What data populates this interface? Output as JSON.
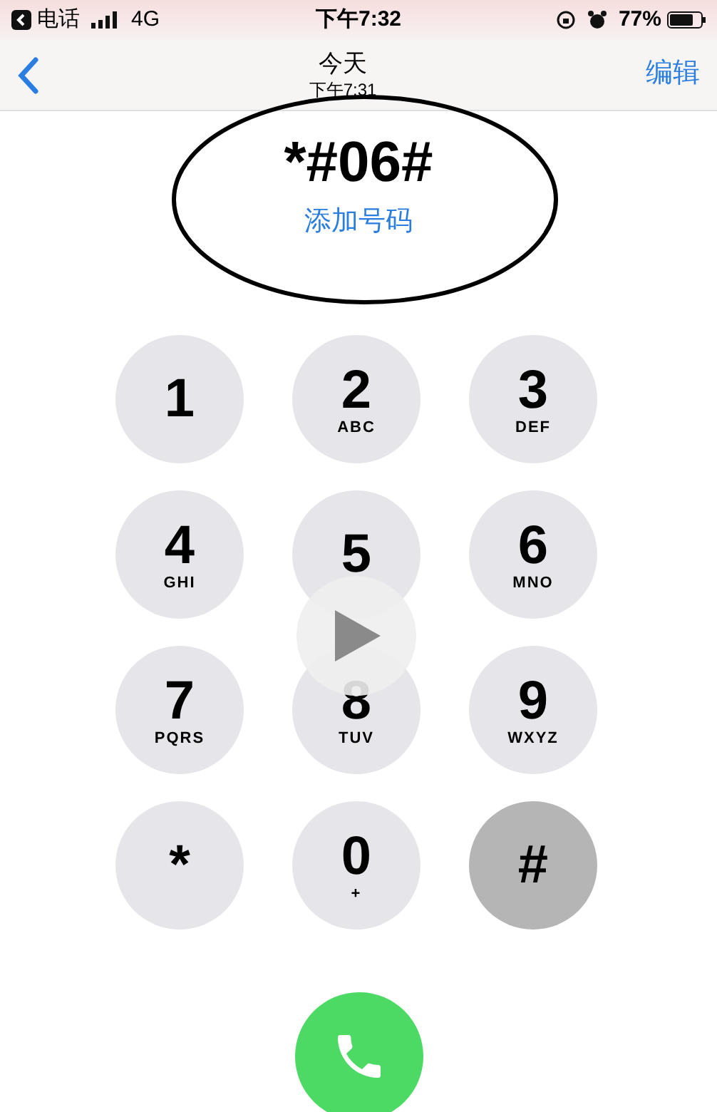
{
  "status_bar": {
    "back_app": "电话",
    "network": "4G",
    "time": "下午7:32",
    "battery": "77%"
  },
  "nav": {
    "title": "今天",
    "subtitle": "下午7:31",
    "edit": "编辑"
  },
  "entry": {
    "number": "*#06#",
    "add_contact": "添加号码",
    "annotated": true
  },
  "keys": [
    {
      "digit": "1",
      "pressed": false
    },
    {
      "digit": "2",
      "letters": "ABC",
      "pressed": false
    },
    {
      "digit": "3",
      "letters": "DEF",
      "pressed": false
    },
    {
      "digit": "4",
      "letters": "GHI",
      "pressed": false
    },
    {
      "digit": "5",
      "pressed": false
    },
    {
      "digit": "6",
      "letters": "MNO",
      "pressed": false
    },
    {
      "digit": "7",
      "letters": "PQRS",
      "pressed": false
    },
    {
      "digit": "8",
      "letters": "TUV",
      "pressed": false
    },
    {
      "digit": "9",
      "letters": "WXYZ",
      "pressed": false
    },
    {
      "digit": "*",
      "pressed": false
    },
    {
      "digit": "0",
      "letters": "+",
      "pressed": false
    },
    {
      "digit": "#",
      "pressed": true
    }
  ],
  "video_overlay": {
    "shown": true
  }
}
